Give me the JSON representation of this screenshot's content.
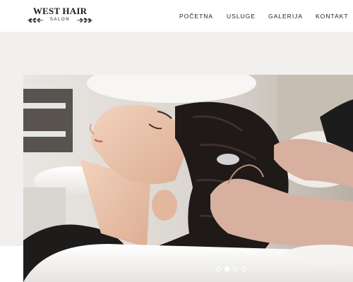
{
  "brand": {
    "title": "WEST HAIR",
    "subtitle": "SALON"
  },
  "nav": {
    "items": [
      {
        "label": "POČETNA"
      },
      {
        "label": "USLUGE"
      },
      {
        "label": "GALERIJA"
      },
      {
        "label": "KONTAKT"
      }
    ]
  },
  "slider": {
    "slide_count": 4,
    "active_index": 1
  },
  "colors": {
    "band": "#f1f0ee",
    "text": "#222222"
  }
}
